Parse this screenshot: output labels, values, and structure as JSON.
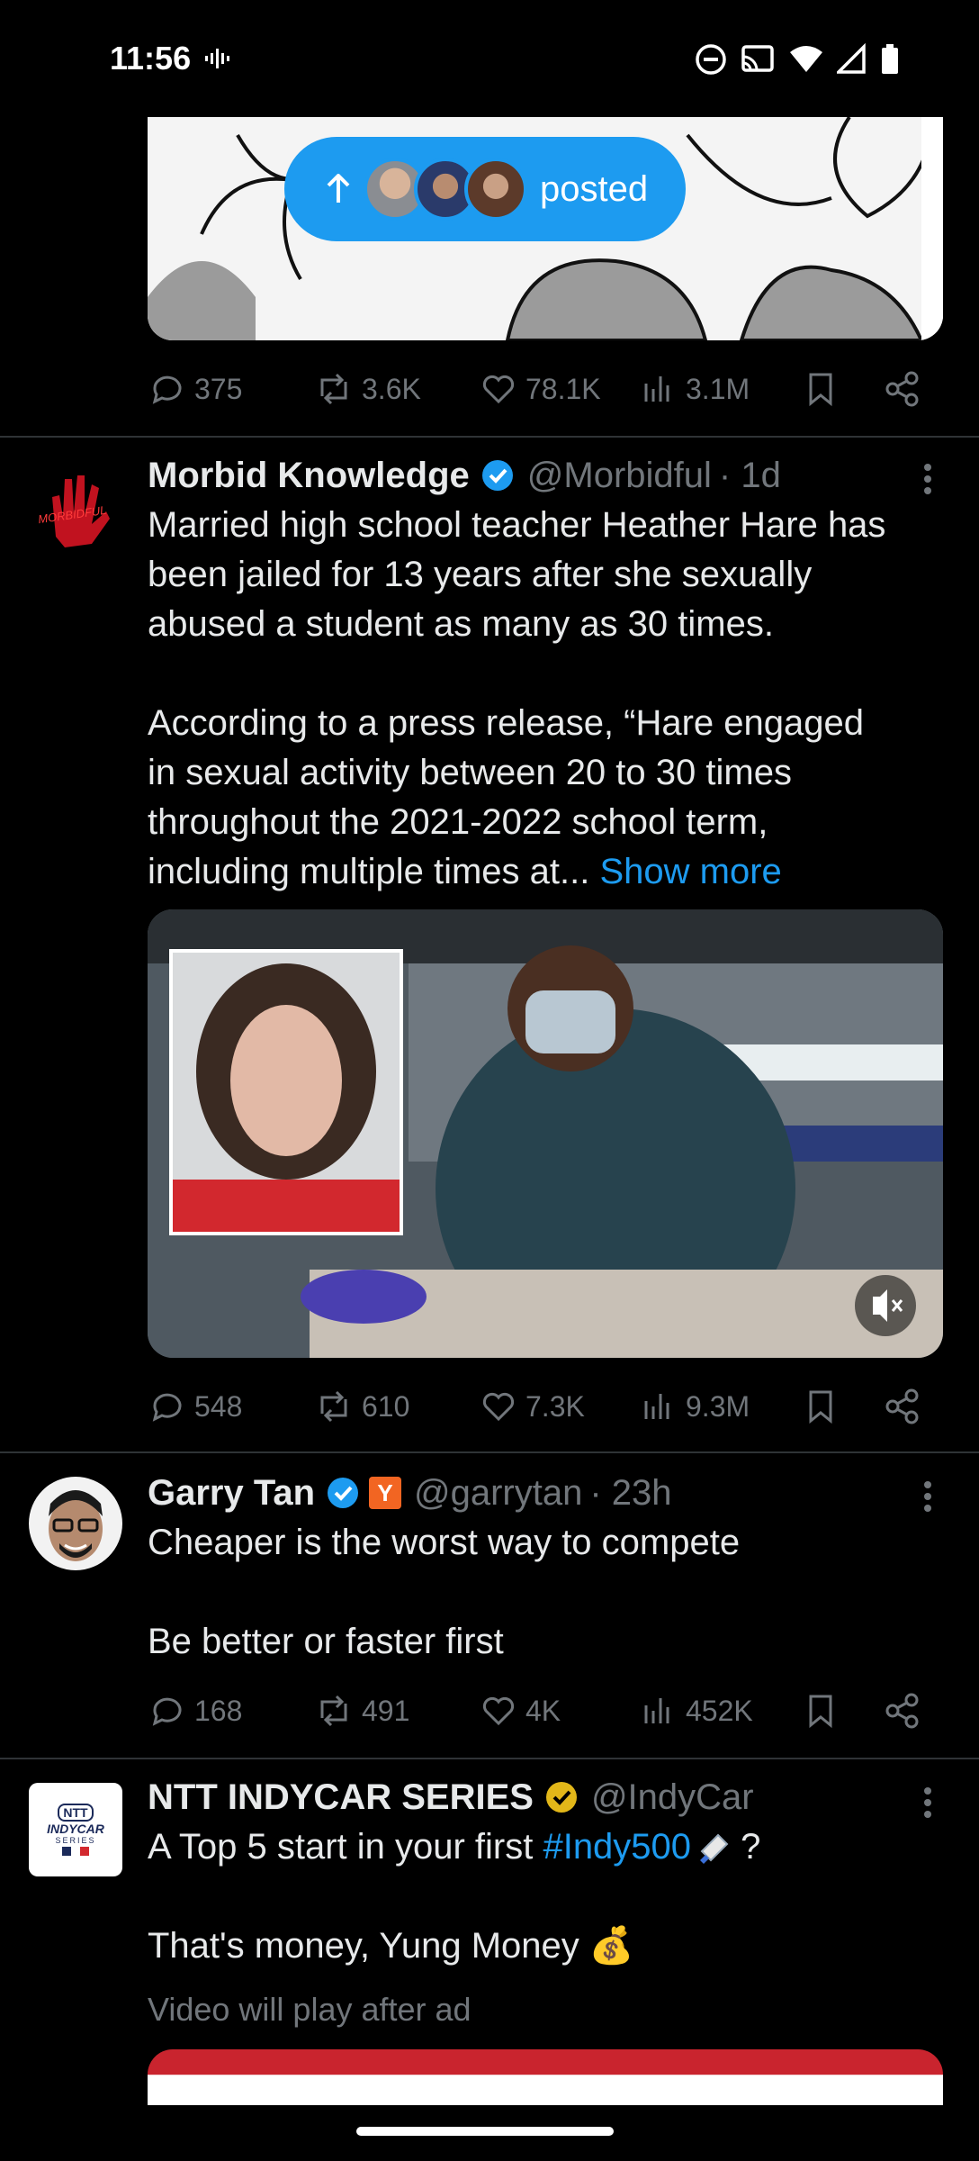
{
  "status_bar": {
    "time": "11:56"
  },
  "pill": {
    "label": "posted"
  },
  "post1": {
    "actions": {
      "replies": "375",
      "reposts": "3.6K",
      "likes": "78.1K",
      "views": "3.1M"
    }
  },
  "post2": {
    "name": "Morbid Knowledge",
    "handle": "@Morbidful",
    "time": "· 1d",
    "avatar_text": "MORBIDFUL",
    "body_line1": "Married high school teacher Heather Hare has\nbeen jailed for 13 years after she sexually\nabused a student as many as 30 times.",
    "body_line2": "According to a press release, “Hare engaged\nin sexual activity between 20 to 30 times\nthroughout the 2021-2022 school term,\nincluding multiple times at...",
    "show_more": "Show more",
    "actions": {
      "replies": "548",
      "reposts": "610",
      "likes": "7.3K",
      "views": "9.3M"
    }
  },
  "post3": {
    "name": "Garry Tan",
    "badge": "Y",
    "handle": "@garrytan",
    "time": "· 23h",
    "body": "Cheaper is the worst way to compete\n\nBe better or faster first",
    "actions": {
      "replies": "168",
      "reposts": "491",
      "likes": "4K",
      "views": "452K"
    }
  },
  "post4": {
    "name": "NTT INDYCAR SERIES",
    "handle": "@IndyCar",
    "avatar_text_1": "NTT",
    "avatar_text_2": "INDYCAR",
    "avatar_text_3": "SERIES",
    "body_prefix": "A Top 5 start in your first ",
    "hashtag": "#Indy500",
    "body_suffix": " ?",
    "body2": "That's money, Yung Money 💰",
    "ad_note": "Video will play after ad"
  },
  "colors": {
    "accent": "#1d9bf0",
    "muted": "#71767b",
    "divider": "#2f3336"
  }
}
